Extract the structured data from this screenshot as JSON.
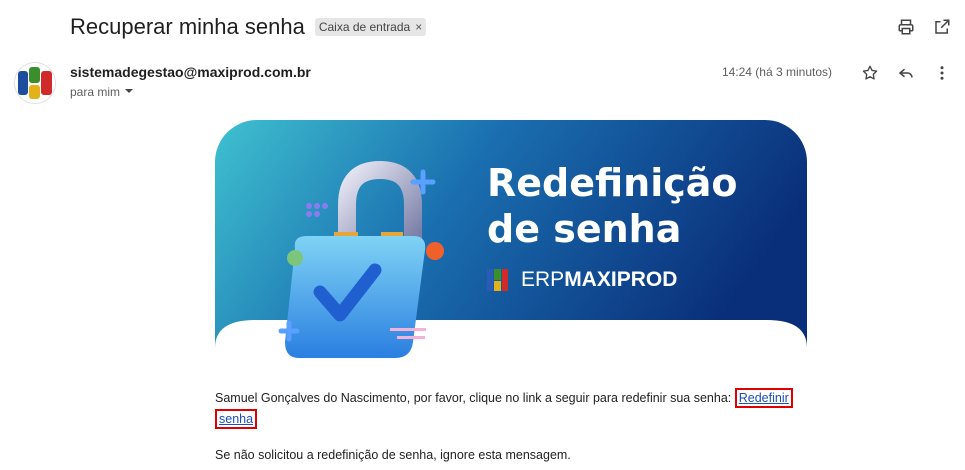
{
  "email": {
    "subject": "Recuperar minha senha",
    "label_chip": "Caixa de entrada",
    "label_remove": "×",
    "sender": "sistemadegestao@maxiprod.com.br",
    "recipient": "para mim",
    "time": "14:24 (há 3 minutos)"
  },
  "banner": {
    "title_line1": "Redefinição",
    "title_line2": "de senha",
    "brand_erp": "ERP",
    "brand_maxi": "MAXIPROD"
  },
  "body": {
    "text_before_link": "Samuel Gonçalves do Nascimento, por favor, clique no link a seguir para redefinir sua senha: ",
    "link_part1": "Redefinir",
    "link_part2": "senha",
    "ignore_text": "Se não solicitou a redefinição de senha, ignore esta mensagem."
  },
  "icons": {
    "print": "printer-icon",
    "popout": "open-in-new-icon",
    "star": "star-icon",
    "reply": "reply-icon",
    "more": "more-vert-icon",
    "dropdown": "chevron-down-icon"
  },
  "colors": {
    "link": "#1a4fb8",
    "highlight": "#e00000",
    "banner_start": "#3fc1d0",
    "banner_end": "#0a2f7a"
  }
}
